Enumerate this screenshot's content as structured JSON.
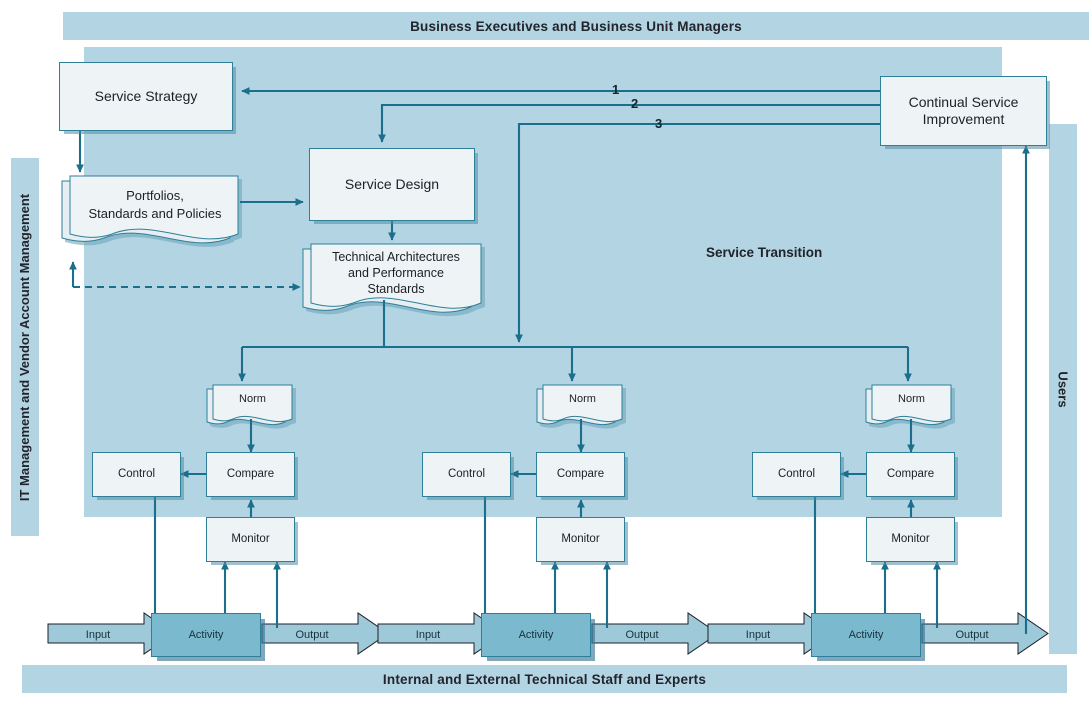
{
  "diagram": {
    "title_top": "Business Executives and Business Unit Managers",
    "title_bottom": "Internal and External Technical Staff and Experts",
    "left_band_label": "IT Management and Vendor Account Management",
    "right_band_label": "Users",
    "panel_label": "Service Transition",
    "colors": {
      "band_blue": "#b3d4e3",
      "panel_blue": "#b3d4e3",
      "box_fill": "#eef3f6",
      "box_stroke": "#2f7f99",
      "activity_fill": "#7bb9cf",
      "line": "#1b6f8c",
      "text": "#1d1f26"
    }
  },
  "boxes": {
    "service_strategy": "Service Strategy",
    "service_design": "Service Design",
    "continual_service_improvement": "Continual Service\nImprovement",
    "csi_line1": "Continual Service",
    "csi_line2": "Improvement",
    "portfolios_line1": "Portfolios,",
    "portfolios_line2": "Standards and Policies",
    "technical_line1": "Technical Architectures",
    "technical_line2": "and Performance",
    "technical_line3": "Standards"
  },
  "feedback_labels": {
    "one": "1",
    "two": "2",
    "three": "3"
  },
  "clusters": [
    {
      "norm": "Norm",
      "control": "Control",
      "compare": "Compare",
      "monitor": "Monitor",
      "activity": "Activity",
      "input": "Input",
      "output": "Output"
    },
    {
      "norm": "Norm",
      "control": "Control",
      "compare": "Compare",
      "monitor": "Monitor",
      "activity": "Activity",
      "input": "Input",
      "output": "Output"
    },
    {
      "norm": "Norm",
      "control": "Control",
      "compare": "Compare",
      "monitor": "Monitor",
      "activity": "Activity",
      "input": "Input",
      "output": "Output"
    }
  ]
}
